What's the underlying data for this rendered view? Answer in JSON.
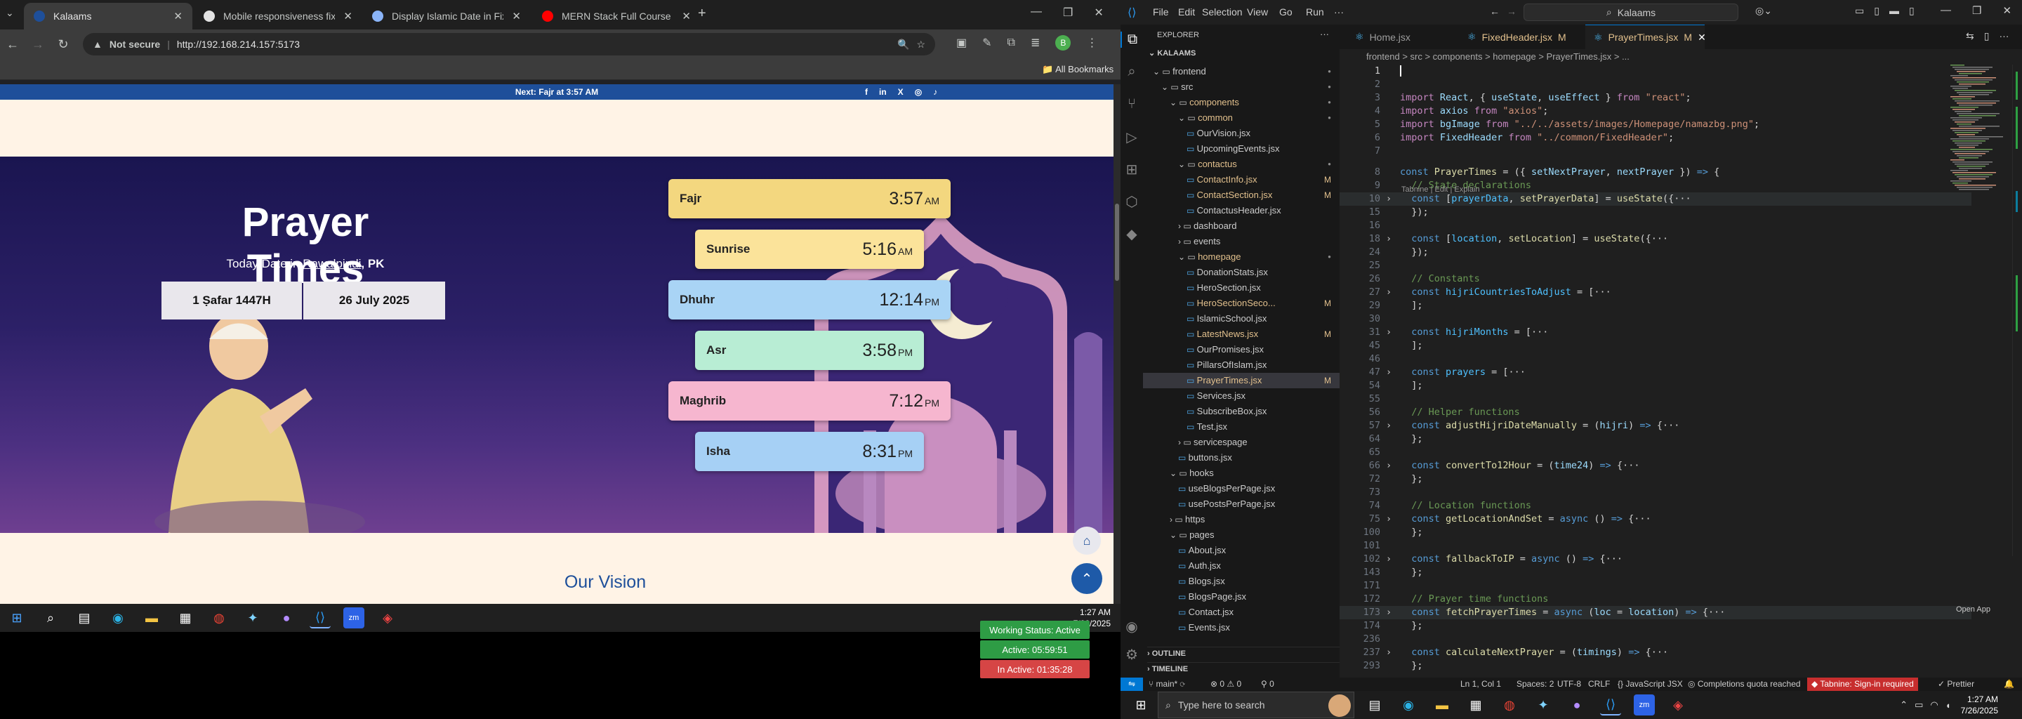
{
  "chrome": {
    "tabs": [
      {
        "title": "Kalaams",
        "active": true,
        "favicon_color": "#1e4f9a"
      },
      {
        "title": "Mobile responsiveness fix",
        "active": false,
        "favicon_color": "#e3e3e3"
      },
      {
        "title": "Display Islamic Date in Fixed He",
        "active": false,
        "favicon_color": "#8ab4f8"
      },
      {
        "title": "MERN Stack Full Course - ECom",
        "active": false,
        "favicon_color": "#ff0000"
      }
    ],
    "new_tab": "+",
    "security_label": "Not secure",
    "url": "http://192.168.214.157:5173",
    "all_bookmarks": "All Bookmarks",
    "profile_initial": "B"
  },
  "site": {
    "top_strip": "Next: Fajr at 3:57 AM",
    "social_icons": [
      "f",
      "in",
      "X",
      "◎",
      "♪"
    ],
    "title": "Prayer Times",
    "date_prefix": "Today Date in ",
    "city": "Rawalpindi",
    "country": ", PK",
    "hijri_date": "1 Ṣafar 1447H",
    "greg_date": "26 July 2025",
    "prayers": [
      {
        "name": "Fajr",
        "time": "3:57",
        "ampm": "AM",
        "color": "#f3d77f"
      },
      {
        "name": "Sunrise",
        "time": "5:16",
        "ampm": "AM",
        "color": "#fbe39a"
      },
      {
        "name": "Dhuhr",
        "time": "12:14",
        "ampm": "PM",
        "color": "#a9d4f5"
      },
      {
        "name": "Asr",
        "time": "3:58",
        "ampm": "PM",
        "color": "#b8edd4"
      },
      {
        "name": "Maghrib",
        "time": "7:12",
        "ampm": "PM",
        "color": "#f6b6cf"
      },
      {
        "name": "Isha",
        "time": "8:31",
        "ampm": "PM",
        "color": "#a6d0f5"
      }
    ],
    "section_heading": "Our Vision"
  },
  "left_clock": {
    "time": "1:27 AM",
    "date": "7/26/2025"
  },
  "vscode": {
    "menu": [
      "File",
      "Edit",
      "Selection",
      "View",
      "Go",
      "Run",
      "···"
    ],
    "search_text": "Kalaams",
    "explorer_title": "EXPLORER",
    "workspace": "KALAAMS",
    "tree": [
      {
        "label": "frontend",
        "depth": 0,
        "type": "open",
        "mark": "●"
      },
      {
        "label": "src",
        "depth": 1,
        "type": "open",
        "mark": "●"
      },
      {
        "label": "components",
        "depth": 2,
        "type": "open",
        "mark": "●",
        "yellow": true
      },
      {
        "label": "common",
        "depth": 3,
        "type": "open",
        "mark": "●",
        "yellow": true
      },
      {
        "label": "OurVision.jsx",
        "depth": 4,
        "type": "file",
        "mark": ""
      },
      {
        "label": "UpcomingEvents.jsx",
        "depth": 4,
        "type": "file",
        "mark": ""
      },
      {
        "label": "contactus",
        "depth": 3,
        "type": "open",
        "mark": "●",
        "yellow": true
      },
      {
        "label": "ContactInfo.jsx",
        "depth": 4,
        "type": "file",
        "mark": "M",
        "yellow": true
      },
      {
        "label": "ContactSection.jsx",
        "depth": 4,
        "type": "file",
        "mark": "M",
        "yellow": true
      },
      {
        "label": "ContactusHeader.jsx",
        "depth": 4,
        "type": "file",
        "mark": ""
      },
      {
        "label": "dashboard",
        "depth": 3,
        "type": "closed",
        "mark": ""
      },
      {
        "label": "events",
        "depth": 3,
        "type": "closed",
        "mark": ""
      },
      {
        "label": "homepage",
        "depth": 3,
        "type": "open",
        "mark": "●",
        "yellow": true
      },
      {
        "label": "DonationStats.jsx",
        "depth": 4,
        "type": "file",
        "mark": ""
      },
      {
        "label": "HeroSection.jsx",
        "depth": 4,
        "type": "file",
        "mark": ""
      },
      {
        "label": "HeroSectionSeco...",
        "depth": 4,
        "type": "file",
        "mark": "M",
        "yellow": true
      },
      {
        "label": "IslamicSchool.jsx",
        "depth": 4,
        "type": "file",
        "mark": ""
      },
      {
        "label": "LatestNews.jsx",
        "depth": 4,
        "type": "file",
        "mark": "M",
        "yellow": true
      },
      {
        "label": "OurPromises.jsx",
        "depth": 4,
        "type": "file",
        "mark": ""
      },
      {
        "label": "PillarsOfIslam.jsx",
        "depth": 4,
        "type": "file",
        "mark": ""
      },
      {
        "label": "PrayerTimes.jsx",
        "depth": 4,
        "type": "file",
        "mark": "M",
        "yellow": true,
        "selected": true
      },
      {
        "label": "Services.jsx",
        "depth": 4,
        "type": "file",
        "mark": ""
      },
      {
        "label": "SubscribeBox.jsx",
        "depth": 4,
        "type": "file",
        "mark": ""
      },
      {
        "label": "Test.jsx",
        "depth": 4,
        "type": "file",
        "mark": ""
      },
      {
        "label": "servicespage",
        "depth": 3,
        "type": "closed",
        "mark": ""
      },
      {
        "label": "buttons.jsx",
        "depth": 3,
        "type": "file",
        "mark": ""
      },
      {
        "label": "hooks",
        "depth": 2,
        "type": "open",
        "mark": ""
      },
      {
        "label": "useBlogsPerPage.jsx",
        "depth": 3,
        "type": "file",
        "mark": ""
      },
      {
        "label": "usePostsPerPage.jsx",
        "depth": 3,
        "type": "file",
        "mark": ""
      },
      {
        "label": "https",
        "depth": 2,
        "type": "closed",
        "mark": ""
      },
      {
        "label": "pages",
        "depth": 2,
        "type": "open",
        "mark": ""
      },
      {
        "label": "About.jsx",
        "depth": 3,
        "type": "file",
        "mark": ""
      },
      {
        "label": "Auth.jsx",
        "depth": 3,
        "type": "file",
        "mark": ""
      },
      {
        "label": "Blogs.jsx",
        "depth": 3,
        "type": "file",
        "mark": ""
      },
      {
        "label": "BlogsPage.jsx",
        "depth": 3,
        "type": "file",
        "mark": ""
      },
      {
        "label": "Contact.jsx",
        "depth": 3,
        "type": "file",
        "mark": ""
      },
      {
        "label": "Events.jsx",
        "depth": 3,
        "type": "file",
        "mark": ""
      }
    ],
    "outline": "OUTLINE",
    "timeline": "TIMELINE",
    "editor_tabs": [
      {
        "label": "Home.jsx",
        "mod": "",
        "active": false
      },
      {
        "label": "FixedHeader.jsx",
        "mod": "M",
        "active": false
      },
      {
        "label": "PrayerTimes.jsx",
        "mod": "M",
        "active": true
      }
    ],
    "breadcrumb": "frontend > src > components > homepage > PrayerTimes.jsx > ...",
    "tabnine_hint": "Tabnine | Edit | Explain",
    "code_lines": [
      {
        "n": "1",
        "html": ""
      },
      {
        "n": "2",
        "html": ""
      },
      {
        "n": "3",
        "html": "<span class='kw2'>import</span> <span class='id'>React</span><span class='pu'>, { </span><span class='id'>useState</span><span class='pu'>, </span><span class='id'>useEffect</span><span class='pu'> } </span><span class='kw2'>from</span> <span class='st'>\"react\"</span><span class='pu'>;</span>"
      },
      {
        "n": "4",
        "html": "<span class='kw2'>import</span> <span class='id'>axios</span> <span class='kw2'>from</span> <span class='st'>\"axios\"</span><span class='pu'>;</span>"
      },
      {
        "n": "5",
        "html": "<span class='kw2'>import</span> <span class='id'>bgImage</span> <span class='kw2'>from</span> <span class='st'>\"../../assets/images/Homepage/namazbg.png\"</span><span class='pu'>;</span>"
      },
      {
        "n": "6",
        "html": "<span class='kw2'>import</span> <span class='id'>FixedHeader</span> <span class='kw2'>from</span> <span class='st'>\"../common/FixedHeader\"</span><span class='pu'>;</span>"
      },
      {
        "n": "7",
        "html": ""
      },
      {
        "n": "8",
        "html": "<span class='kw'>const</span> <span class='fn'>PrayerTimes</span> <span class='pu'>= ({ </span><span class='id'>setNextPrayer</span><span class='pu'>, </span><span class='id'>nextPrayer</span><span class='pu'> }) </span><span class='kw'>=&gt;</span><span class='pu'> {</span>"
      },
      {
        "n": "9",
        "html": "  <span class='cm'>// State declarations</span>"
      },
      {
        "n": "10",
        "html": "  <span class='kw'>const</span> <span class='pu'>[</span><span class='cn'>prayerData</span><span class='pu'>, </span><span class='fn'>setPrayerData</span><span class='pu'>] = </span><span class='fn'>useState</span><span class='pu'>({···</span>"
      },
      {
        "n": "15",
        "html": "  <span class='pu'>});</span>"
      },
      {
        "n": "16",
        "html": ""
      },
      {
        "n": "18",
        "html": "  <span class='kw'>const</span> <span class='pu'>[</span><span class='cn'>location</span><span class='pu'>, </span><span class='fn'>setLocation</span><span class='pu'>] = </span><span class='fn'>useState</span><span class='pu'>({···</span>"
      },
      {
        "n": "24",
        "html": "  <span class='pu'>});</span>"
      },
      {
        "n": "25",
        "html": ""
      },
      {
        "n": "26",
        "html": "  <span class='cm'>// Constants</span>"
      },
      {
        "n": "27",
        "html": "  <span class='kw'>const</span> <span class='cn'>hijriCountriesToAdjust</span> <span class='pu'>= [···</span>"
      },
      {
        "n": "29",
        "html": "  <span class='pu'>];</span>"
      },
      {
        "n": "30",
        "html": ""
      },
      {
        "n": "31",
        "html": "  <span class='kw'>const</span> <span class='cn'>hijriMonths</span> <span class='pu'>= [···</span>"
      },
      {
        "n": "45",
        "html": "  <span class='pu'>];</span>"
      },
      {
        "n": "46",
        "html": ""
      },
      {
        "n": "47",
        "html": "  <span class='kw'>const</span> <span class='cn'>prayers</span> <span class='pu'>= [···</span>"
      },
      {
        "n": "54",
        "html": "  <span class='pu'>];</span>"
      },
      {
        "n": "55",
        "html": ""
      },
      {
        "n": "56",
        "html": "  <span class='cm'>// Helper functions</span>"
      },
      {
        "n": "57",
        "html": "  <span class='kw'>const</span> <span class='fn'>adjustHijriDateManually</span> <span class='pu'>= (</span><span class='id'>hijri</span><span class='pu'>) </span><span class='kw'>=&gt;</span><span class='pu'> {···</span>"
      },
      {
        "n": "64",
        "html": "  <span class='pu'>};</span>"
      },
      {
        "n": "65",
        "html": ""
      },
      {
        "n": "66",
        "html": "  <span class='kw'>const</span> <span class='fn'>convertTo12Hour</span> <span class='pu'>= (</span><span class='id'>time24</span><span class='pu'>) </span><span class='kw'>=&gt;</span><span class='pu'> {···</span>"
      },
      {
        "n": "72",
        "html": "  <span class='pu'>};</span>"
      },
      {
        "n": "73",
        "html": ""
      },
      {
        "n": "74",
        "html": "  <span class='cm'>// Location functions</span>"
      },
      {
        "n": "75",
        "html": "  <span class='kw'>const</span> <span class='fn'>getLocationAndSet</span> <span class='pu'>= </span><span class='kw'>async</span><span class='pu'> () </span><span class='kw'>=&gt;</span><span class='pu'> {···</span>"
      },
      {
        "n": "100",
        "html": "  <span class='pu'>};</span>"
      },
      {
        "n": "101",
        "html": ""
      },
      {
        "n": "102",
        "html": "  <span class='kw'>const</span> <span class='fn'>fallbackToIP</span> <span class='pu'>= </span><span class='kw'>async</span><span class='pu'> () </span><span class='kw'>=&gt;</span><span class='pu'> {···</span>"
      },
      {
        "n": "143",
        "html": "  <span class='pu'>};</span>"
      },
      {
        "n": "171",
        "html": ""
      },
      {
        "n": "172",
        "html": "  <span class='cm'>// Prayer time functions</span>"
      },
      {
        "n": "173",
        "html": "  <span class='kw'>const</span> <span class='fn'>fetchPrayerTimes</span> <span class='pu'>= </span><span class='kw'>async</span><span class='pu'> (</span><span class='id'>loc</span> <span class='pu'>= </span><span class='id'>location</span><span class='pu'>) </span><span class='kw'>=&gt;</span><span class='pu'> {···</span>"
      },
      {
        "n": "174",
        "html": "  <span class='pu'>};</span>"
      },
      {
        "n": "236",
        "html": ""
      },
      {
        "n": "237",
        "html": "  <span class='kw'>const</span> <span class='fn'>calculateNextPrayer</span> <span class='pu'>= (</span><span class='id'>timings</span><span class='pu'>) </span><span class='kw'>=&gt;</span><span class='pu'> {···</span>"
      },
      {
        "n": "293",
        "html": "  <span class='pu'>};</span>"
      }
    ],
    "fold_lines": [
      "10",
      "18",
      "27",
      "31",
      "47",
      "57",
      "66",
      "75",
      "102",
      "173",
      "237"
    ],
    "statusbar": {
      "branch": "main*",
      "errors": "⊗ 0 ⚠ 0",
      "ports": "0",
      "position": "Ln 1, Col 1",
      "spaces": "Spaces: 2",
      "encoding": "UTF-8",
      "eol": "CRLF",
      "language": "{} JavaScript JSX",
      "quota": "Completions quota reached",
      "tabnine": "Tabnine: Sign-in required",
      "prettier": "Prettier"
    },
    "open_app": "Open App",
    "work_status": "Working Status: Active",
    "active_time": "Active: 05:59:51",
    "inactive_time": "In Active: 01:35:28",
    "inactive_label": "In Active: 01:35:28"
  },
  "right_taskbar": {
    "search_placeholder": "Type here to search",
    "time": "1:27 AM",
    "date": "7/26/2025"
  }
}
